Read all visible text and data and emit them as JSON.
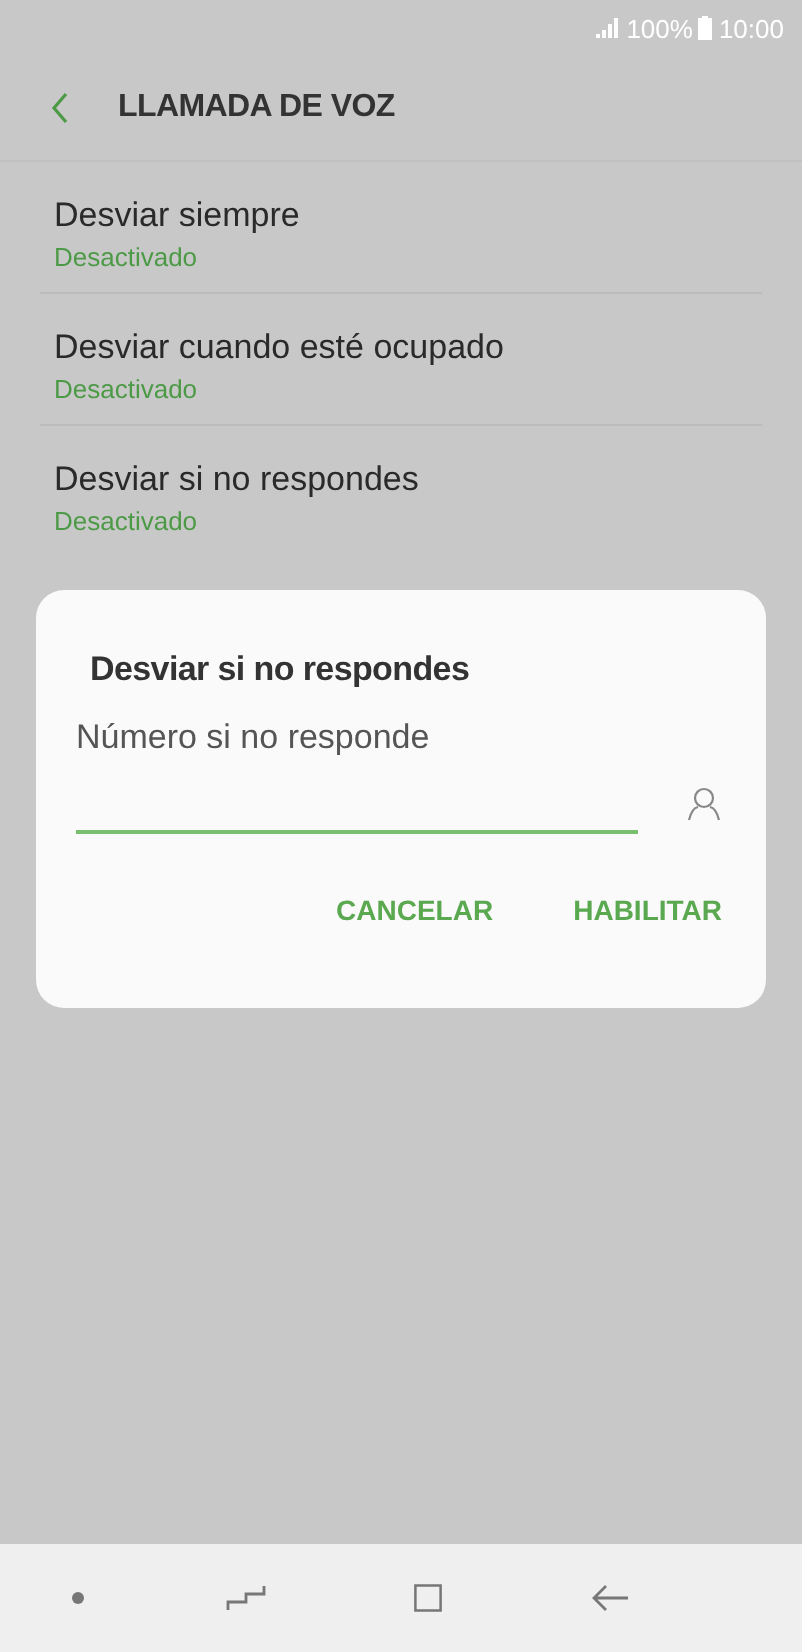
{
  "status_bar": {
    "battery": "100%",
    "time": "10:00"
  },
  "header": {
    "title": "LLAMADA DE VOZ"
  },
  "settings": [
    {
      "title": "Desviar siempre",
      "status": "Desactivado"
    },
    {
      "title": "Desviar cuando esté ocupado",
      "status": "Desactivado"
    },
    {
      "title": "Desviar si no respondes",
      "status": "Desactivado"
    }
  ],
  "dialog": {
    "title": "Desviar si no respondes",
    "field": {
      "placeholder": "Número si no responde"
    },
    "buttons": [
      "CANCELAR",
      "HABILITAR"
    ]
  }
}
